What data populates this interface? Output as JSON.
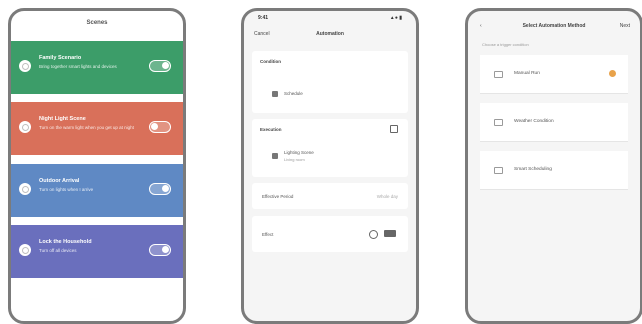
{
  "phone1": {
    "title": "Scenes",
    "scenes": [
      {
        "name": "Family Scenario",
        "desc": "Bring together smart lights and devices",
        "color": "#3c9d69",
        "on": true
      },
      {
        "name": "Night Light Scene",
        "desc": "Turn on the warm light when you get up at night",
        "color": "#d9705a",
        "on": false
      },
      {
        "name": "Outdoor Arrival",
        "desc": "Turn on lights when I arrive",
        "color": "#5f89c4",
        "on": true
      },
      {
        "name": "Lock the Household",
        "desc": "Turn off all devices",
        "color": "#6a6fbd",
        "on": true
      }
    ]
  },
  "phone2": {
    "time": "9:41",
    "signal": "▴ ● ▮",
    "back": "Cancel",
    "title": "Automation",
    "section1": "Condition",
    "condition_item": "Schedule",
    "section2": "Execution",
    "execution_item": "Lighting Scene",
    "execution_sub": "Living room",
    "effective_label": "Effective Period",
    "effective_value": "Whole day",
    "effect_label": "Effect"
  },
  "phone3": {
    "back": "‹",
    "title": "Select Automation Method",
    "next": "Next",
    "subtitle": "Choose a trigger condition",
    "items": [
      {
        "label": "Manual Run",
        "icon": "tap-icon"
      },
      {
        "label": "Weather Condition",
        "icon": "weather-icon"
      },
      {
        "label": "Smart Scheduling",
        "icon": "clock-icon"
      }
    ],
    "accent": "#e8a24a"
  }
}
